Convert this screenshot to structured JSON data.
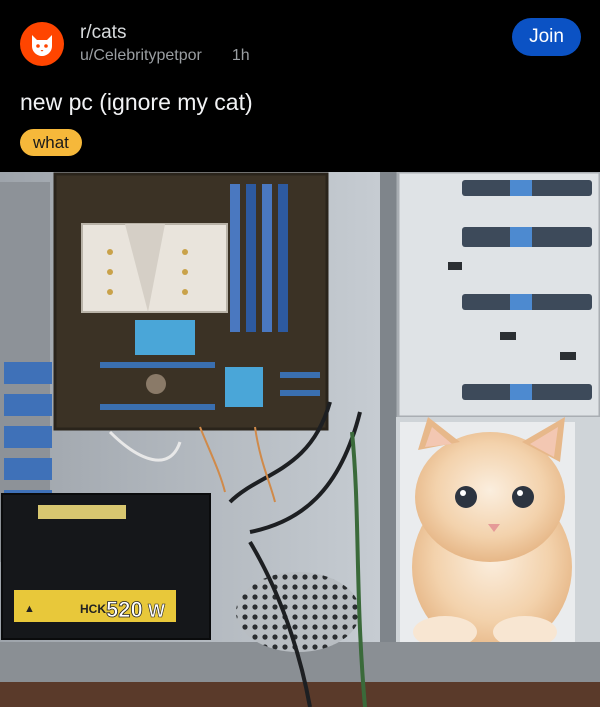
{
  "post": {
    "subreddit": "r/cats",
    "username": "u/Celebritypetpor",
    "time": "1h",
    "join_label": "Join",
    "title": "new pc (ignore my cat)",
    "flair": "what"
  },
  "colors": {
    "background": "#000000",
    "subreddit_icon": "#ff4500",
    "join_button": "#0b52c4",
    "flair": "#f6b83a",
    "psu_label": "#e8c83a"
  },
  "image": {
    "psu_model_text": "HCK",
    "psu_wattage_text": "520",
    "psu_unit_text": "W"
  }
}
